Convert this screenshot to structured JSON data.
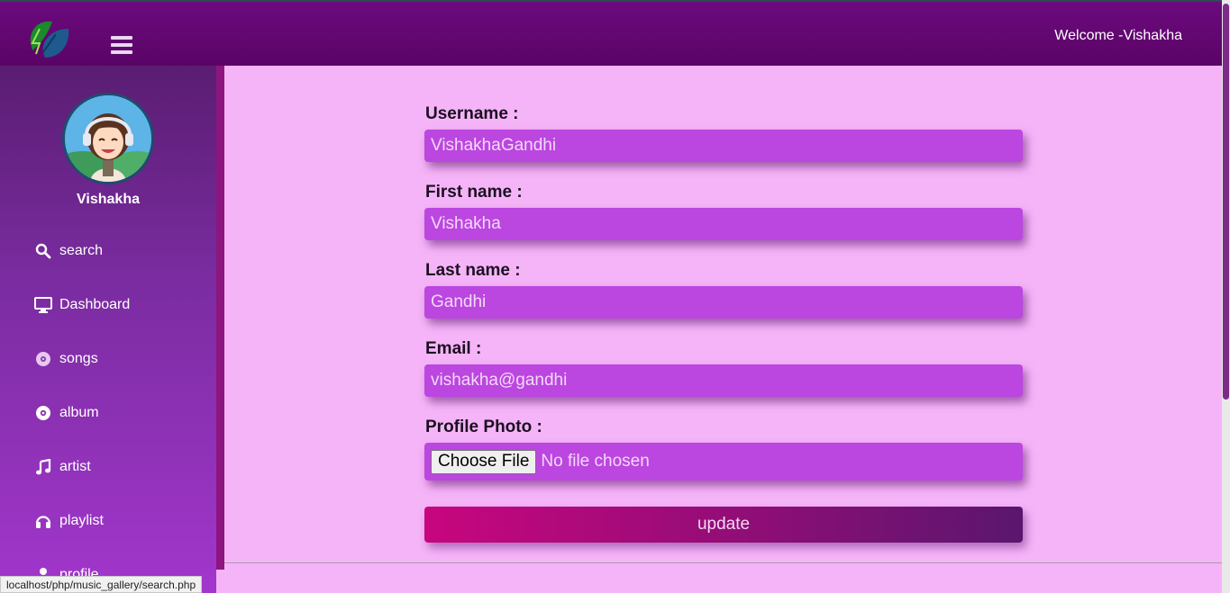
{
  "header": {
    "welcome_text": "Welcome -Vishakha",
    "logo_icon": "leaf-logo-icon",
    "menu_icon": "hamburger-icon"
  },
  "sidebar": {
    "user_name": "Vishakha",
    "items": [
      {
        "label": "search",
        "icon": "search-icon"
      },
      {
        "label": "Dashboard",
        "icon": "monitor-icon"
      },
      {
        "label": "songs",
        "icon": "disc-icon"
      },
      {
        "label": "album",
        "icon": "record-icon"
      },
      {
        "label": "artist",
        "icon": "music-note-icon"
      },
      {
        "label": "playlist",
        "icon": "headphones-icon"
      },
      {
        "label": "profile",
        "icon": "user-icon"
      }
    ]
  },
  "form": {
    "username_label": "Username :",
    "username_value": "VishakhaGandhi",
    "firstname_label": "First name :",
    "firstname_value": "Vishakha",
    "lastname_label": "Last name :",
    "lastname_value": "Gandhi",
    "email_label": "Email :",
    "email_value": "vishakha@gandhi",
    "photo_label": "Profile Photo :",
    "choose_file_label": "Choose File",
    "no_file_text": "No file chosen",
    "update_label": "update"
  },
  "statusbar": {
    "url": "localhost/php/music_gallery/search.php"
  },
  "colors": {
    "header": "#6c0a7e",
    "page_bg": "#f6b4f8",
    "field_bg": "#bc46e0",
    "button_start": "#c8067e",
    "button_end": "#5a166e"
  }
}
